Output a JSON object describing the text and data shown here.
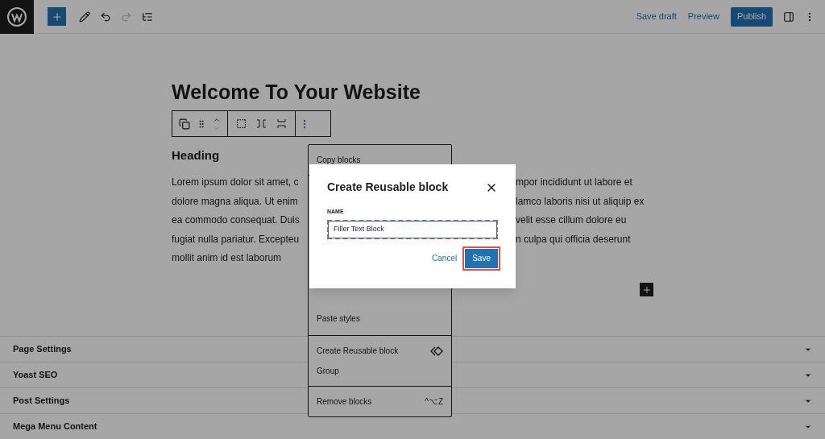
{
  "topbar": {
    "save_draft": "Save draft",
    "preview": "Preview",
    "publish": "Publish"
  },
  "editor": {
    "title": "Welcome To Your Website",
    "heading": "Heading",
    "paragraph_lines": [
      {
        "left": "Lorem ipsum dolor sit amet, c",
        "right": "mpor incididunt ut labore et"
      },
      {
        "left": "dolore magna aliqua. Ut enim",
        "right": "lamco laboris nisi ut aliquip ex"
      },
      {
        "left": "ea commodo consequat. Duis",
        "right": "velit esse cillum dolore eu"
      },
      {
        "left": "fugiat nulla pariatur. Excepteu",
        "right": "n culpa qui officia deserunt"
      },
      {
        "left": "mollit anim id est laborum"
      }
    ]
  },
  "block_menu": {
    "groups": [
      [
        {
          "label": "Copy blocks"
        }
      ],
      [
        {
          "label": "Paste styles"
        }
      ],
      [
        {
          "label": "Create Reusable block",
          "kind": "icon"
        },
        {
          "label": "Group"
        }
      ],
      [
        {
          "label": "Remove blocks",
          "shortcut": "^⌥Z"
        }
      ]
    ]
  },
  "panels": [
    {
      "title": "Page Settings",
      "expanded": false
    },
    {
      "title": "Yoast SEO",
      "expanded": false
    },
    {
      "title": "Post Settings",
      "expanded": false
    },
    {
      "title": "Mega Menu Content",
      "expanded": false
    }
  ],
  "dialog": {
    "title": "Create Reusable block",
    "field_label": "NAME",
    "value": "Filler Text Block",
    "cancel": "Cancel",
    "save": "Save"
  }
}
